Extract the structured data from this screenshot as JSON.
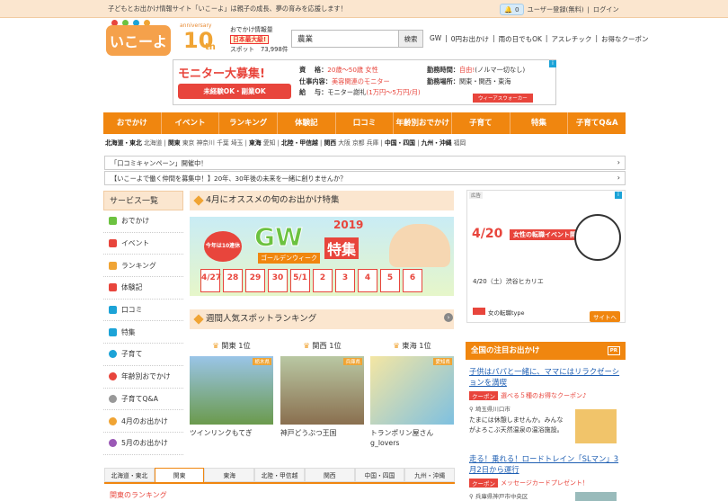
{
  "topbar": {
    "tagline": "子どもとお出かけ情報サイト「いこーよ」は親子の成長、夢の育みを応援します！",
    "notif_count": "0",
    "register": "ユーザー登録(無料)",
    "separator": "|",
    "login": "ログイン"
  },
  "header": {
    "logo_text": "いこーよ",
    "anniv_word": "anniversary",
    "anniv_num": "10",
    "anniv_suffix": "th",
    "info_title": "おでかけ情報量",
    "info_badge": "日本最大級!",
    "spots_label": "スポット",
    "spots_count": "73,998件",
    "search_value": "農業",
    "search_button": "検索",
    "quick_links": [
      "GW",
      "0円お出かけ",
      "雨の日でもOK",
      "アスレチック",
      "お得なクーポン"
    ]
  },
  "banner_ad": {
    "headline": "モニター大募集!",
    "pill": "未経験OK・副業OK",
    "qual_label": "資　 格：",
    "qual_value": "20歳〜50歳 女性",
    "job_label": "仕事内容：",
    "job_value": "美容関連のモニター",
    "pay_label": "給　 与：",
    "pay_value": "モニター謝礼",
    "pay_note": "(1万円〜5万円/月)",
    "time_label": "勤務時間：",
    "time_value": "自由!",
    "time_note": "(ノルマ一切なし)",
    "place_label": "勤務場所：",
    "place_value": "関東・関西・東海",
    "brand": "ウィーアスウォーカー"
  },
  "nav": [
    "おでかけ",
    "イベント",
    "ランキング",
    "体験記",
    "口コミ",
    "年齢別おでかけ",
    "子育て",
    "特集",
    "子育てQ&A"
  ],
  "regions": [
    {
      "name": "北海道・東北",
      "items": [
        "北海道"
      ]
    },
    {
      "name": "関東",
      "items": [
        "東京",
        "神奈川",
        "千葉",
        "埼玉"
      ]
    },
    {
      "name": "東海",
      "items": [
        "愛知"
      ]
    },
    {
      "name": "北陸・甲信越",
      "items": []
    },
    {
      "name": "関西",
      "items": [
        "大阪",
        "京都",
        "兵庫"
      ]
    },
    {
      "name": "中国・四国",
      "items": []
    },
    {
      "name": "九州・沖縄",
      "items": [
        "福岡"
      ]
    }
  ],
  "notices": [
    "「口コミキャンペーン」開催中！",
    "【いこーよで働く仲間を募集中！】20年、30年後の未来を一緒に創りませんか？"
  ],
  "sidebar": {
    "title": "サービス一覧",
    "items": [
      "おでかけ",
      "イベント",
      "ランキング",
      "体験記",
      "口コミ",
      "特集",
      "子育て",
      "年齢別おでかけ",
      "子育てQ&A",
      "4月のお出かけ",
      "5月のお出かけ"
    ],
    "colors": [
      "#6cc240",
      "#e8453c",
      "#f0a434",
      "#e8453c",
      "#1ca3d7",
      "#1ca3d7",
      "#1ca3d7",
      "#e8453c",
      "#999999",
      "#f0a434",
      "#9b59b6"
    ]
  },
  "feature": {
    "title": "4月にオススメの旬のお出かけ特集",
    "gw_big": "GW",
    "gw_year": "2019",
    "gw_tokushu": "特集",
    "gw_sub": "ゴールデンウィーク",
    "gw_ten": "今年は10連休",
    "dates": [
      "4/27",
      "28",
      "29",
      "30",
      "5/1",
      "2",
      "3",
      "4",
      "5",
      "6"
    ]
  },
  "ranking": {
    "title": "週間人気スポットランキング",
    "items": [
      {
        "region": "関東 1位",
        "pref": "栃木県",
        "name": "ツインリンクもてぎ"
      },
      {
        "region": "関西 1位",
        "pref": "兵庫県",
        "name": "神戸どうぶつ王国"
      },
      {
        "region": "東海 1位",
        "pref": "愛知県",
        "name": "トランポリン屋さん g_lovers"
      }
    ]
  },
  "tabs": [
    "北海道・東北",
    "関東",
    "東海",
    "北陸・甲信越",
    "関西",
    "中国・四国",
    "九州・沖縄"
  ],
  "bottom_heading": "関東のランキング",
  "right_ad": {
    "label": "広告",
    "headline": "4/20",
    "headline_tag": "女性の転職イベント開催!",
    "caption": "4/20（土）渋谷ヒカリエ",
    "brand": "女の転職type",
    "site_btn": "サイトへ"
  },
  "national": {
    "title": "全国の注目お出かけ",
    "pr": "PR",
    "items": [
      {
        "title": "子供はパパと一緒に、ママにはリラクゼーションを満喫",
        "coupon_badge": "クーポン",
        "coupon": "選べる５種のお得なクーポン♪",
        "location": "埼玉県川口市",
        "desc": "たまには休憩しませんか。みんながよろこぶ天然温泉の温浴施設。"
      },
      {
        "title": "走る！乗れる！ロードトレイン「SLマン」3月2日から運行",
        "coupon_badge": "クーポン",
        "coupon": "メッセージカードプレゼント！",
        "location": "兵庫県神戸市中央区",
        "desc": ""
      }
    ]
  }
}
